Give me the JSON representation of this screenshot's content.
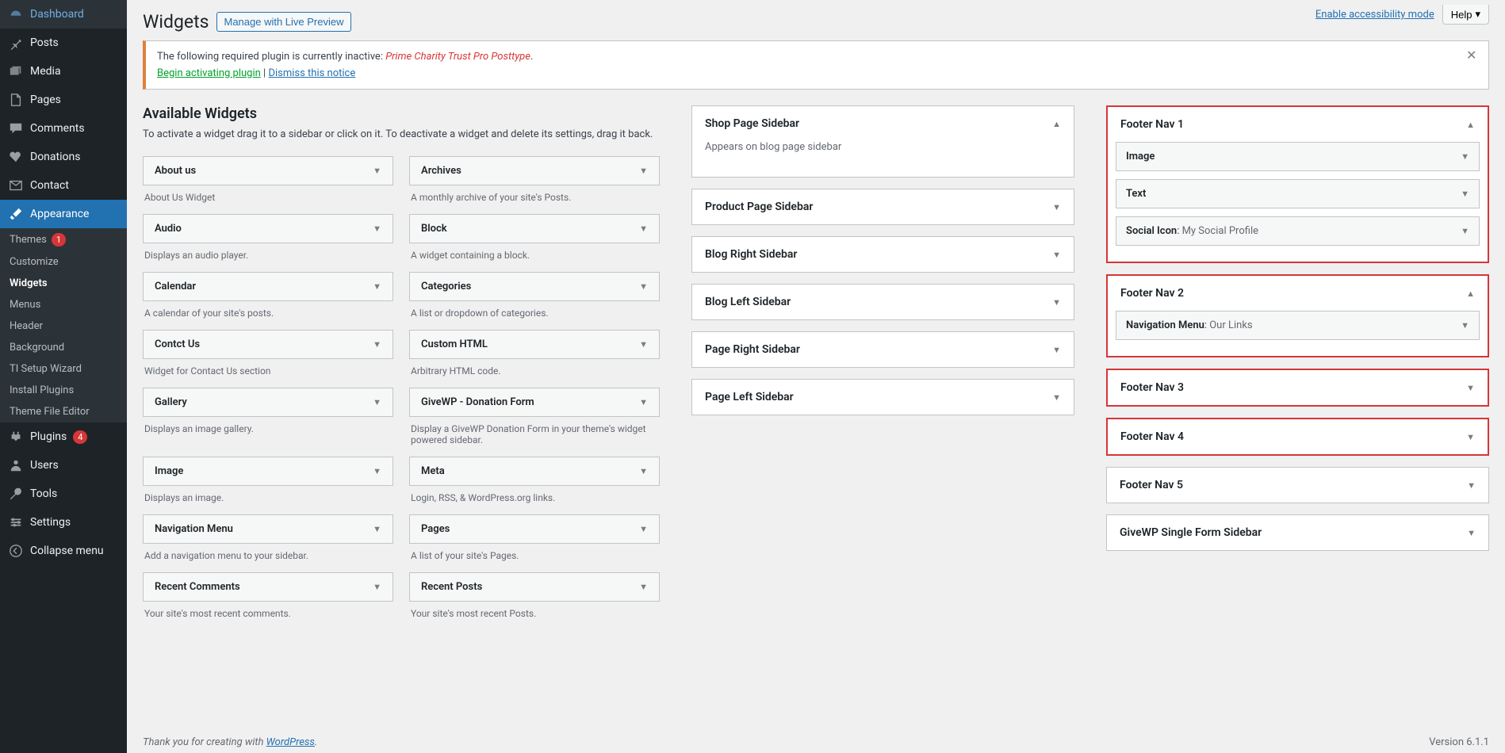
{
  "sidebar": {
    "items": [
      {
        "icon": "dashboard",
        "label": "Dashboard"
      },
      {
        "icon": "pin",
        "label": "Posts"
      },
      {
        "icon": "media",
        "label": "Media"
      },
      {
        "icon": "page",
        "label": "Pages"
      },
      {
        "icon": "comment",
        "label": "Comments"
      },
      {
        "icon": "heart",
        "label": "Donations"
      },
      {
        "icon": "mail",
        "label": "Contact"
      },
      {
        "icon": "brush",
        "label": "Appearance"
      },
      {
        "icon": "plugin",
        "label": "Plugins",
        "badge": "4"
      },
      {
        "icon": "user",
        "label": "Users"
      },
      {
        "icon": "tool",
        "label": "Tools"
      },
      {
        "icon": "settings",
        "label": "Settings"
      },
      {
        "icon": "collapse",
        "label": "Collapse menu"
      }
    ],
    "sub": [
      {
        "label": "Themes",
        "badge": "1"
      },
      {
        "label": "Customize"
      },
      {
        "label": "Widgets"
      },
      {
        "label": "Menus"
      },
      {
        "label": "Header"
      },
      {
        "label": "Background"
      },
      {
        "label": "TI Setup Wizard"
      },
      {
        "label": "Install Plugins"
      },
      {
        "label": "Theme File Editor"
      }
    ]
  },
  "top": {
    "accessibility": "Enable accessibility mode",
    "help": "Help"
  },
  "header": {
    "title": "Widgets",
    "preview_btn": "Manage with Live Preview"
  },
  "notice": {
    "prefix": "The following required plugin is currently inactive: ",
    "plugin": "Prime Charity Trust Pro Posttype",
    "begin": "Begin activating plugin",
    "sep": " | ",
    "dismiss": "Dismiss this notice"
  },
  "available": {
    "title": "Available Widgets",
    "desc": "To activate a widget drag it to a sidebar or click on it. To deactivate a widget and delete its settings, drag it back.",
    "widgets": [
      {
        "name": "About us",
        "desc": "About Us Widget"
      },
      {
        "name": "Archives",
        "desc": "A monthly archive of your site's Posts."
      },
      {
        "name": "Audio",
        "desc": "Displays an audio player."
      },
      {
        "name": "Block",
        "desc": "A widget containing a block."
      },
      {
        "name": "Calendar",
        "desc": "A calendar of your site's posts."
      },
      {
        "name": "Categories",
        "desc": "A list or dropdown of categories."
      },
      {
        "name": "Contct Us",
        "desc": "Widget for Contact Us section"
      },
      {
        "name": "Custom HTML",
        "desc": "Arbitrary HTML code."
      },
      {
        "name": "Gallery",
        "desc": "Displays an image gallery."
      },
      {
        "name": "GiveWP - Donation Form",
        "desc": "Display a GiveWP Donation Form in your theme's widget powered sidebar."
      },
      {
        "name": "Image",
        "desc": "Displays an image."
      },
      {
        "name": "Meta",
        "desc": "Login, RSS, & WordPress.org links."
      },
      {
        "name": "Navigation Menu",
        "desc": "Add a navigation menu to your sidebar."
      },
      {
        "name": "Pages",
        "desc": "A list of your site's Pages."
      },
      {
        "name": "Recent Comments",
        "desc": "Your site's most recent comments."
      },
      {
        "name": "Recent Posts",
        "desc": "Your site's most recent Posts."
      }
    ]
  },
  "areas_mid": [
    {
      "title": "Shop Page Sidebar",
      "open": true,
      "desc": "Appears on blog page sidebar"
    },
    {
      "title": "Product Page Sidebar"
    },
    {
      "title": "Blog Right Sidebar"
    },
    {
      "title": "Blog Left Sidebar"
    },
    {
      "title": "Page Right Sidebar"
    },
    {
      "title": "Page Left Sidebar"
    }
  ],
  "areas_right": [
    {
      "title": "Footer Nav 1",
      "hl": true,
      "open": true,
      "widgets": [
        {
          "label": "Image"
        },
        {
          "label": "Text"
        },
        {
          "label": "Social Icon",
          "sub": "My Social Profile"
        }
      ]
    },
    {
      "title": "Footer Nav 2",
      "hl": true,
      "open": true,
      "widgets": [
        {
          "label": "Navigation Menu",
          "sub": "Our Links"
        }
      ]
    },
    {
      "title": "Footer Nav 3",
      "hl": true
    },
    {
      "title": "Footer Nav 4",
      "hl": true
    },
    {
      "title": "Footer Nav 5"
    },
    {
      "title": "GiveWP Single Form Sidebar"
    }
  ],
  "footer": {
    "thanks_prefix": "Thank you for creating with ",
    "wp": "WordPress",
    "version": "Version 6.1.1"
  }
}
